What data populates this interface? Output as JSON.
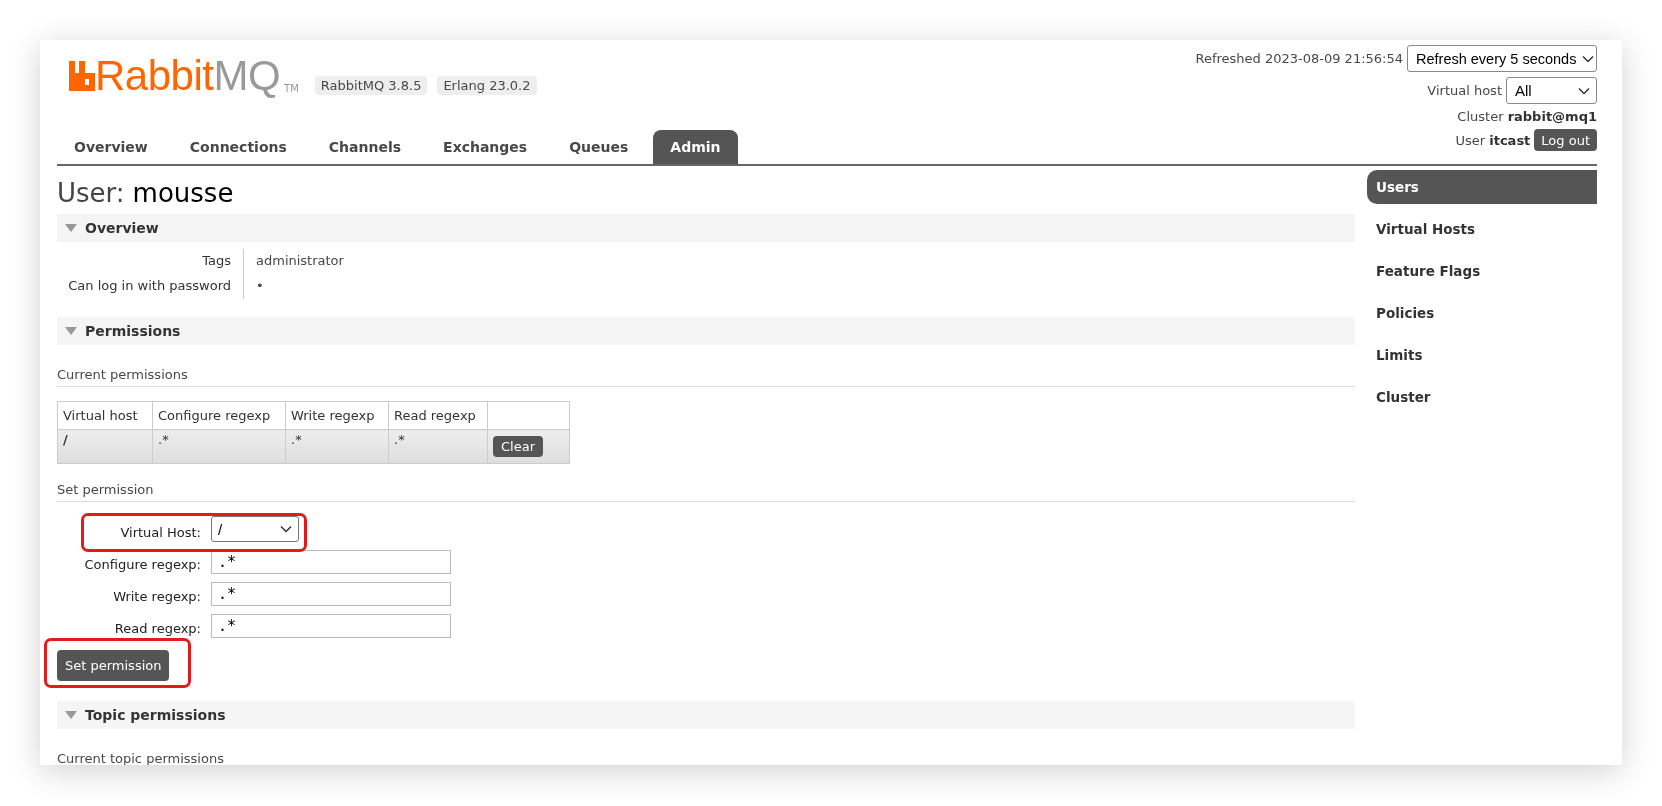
{
  "logo": {
    "brand": "Rabbit",
    "product": "MQ",
    "mark": "TM"
  },
  "versions": [
    "RabbitMQ 3.8.5",
    "Erlang 23.0.2"
  ],
  "tabs": [
    {
      "label": "Overview",
      "selected": false
    },
    {
      "label": "Connections",
      "selected": false
    },
    {
      "label": "Channels",
      "selected": false
    },
    {
      "label": "Exchanges",
      "selected": false
    },
    {
      "label": "Queues",
      "selected": false
    },
    {
      "label": "Admin",
      "selected": true
    }
  ],
  "header": {
    "refreshed": "Refreshed 2023-08-09 21:56:54",
    "refresh_select": "Refresh every 5 seconds",
    "vhost_label": "Virtual host",
    "vhost_select": "All",
    "cluster_label": "Cluster",
    "cluster": "rabbit@mq1",
    "user_label": "User",
    "user": "itcast",
    "logout": "Log out"
  },
  "page_title": {
    "prefix": "User:",
    "name": "mousse"
  },
  "overview": {
    "title": "Overview",
    "expanded": true,
    "rows": [
      {
        "label": "Tags",
        "value": "administrator"
      },
      {
        "label": "Can log in with password",
        "value": "•"
      }
    ]
  },
  "permissions": {
    "title": "Permissions",
    "expanded": true,
    "current_heading": "Current permissions",
    "table": {
      "columns": [
        "Virtual host",
        "Configure regexp",
        "Write regexp",
        "Read regexp"
      ],
      "rows": [
        {
          "cells": [
            "/",
            ".*",
            ".*",
            ".*"
          ],
          "action": "Clear"
        }
      ]
    },
    "set_heading": "Set permission",
    "form": [
      {
        "kind": "select",
        "label": "Virtual Host:",
        "value": "/",
        "highlighted": true
      },
      {
        "kind": "text",
        "label": "Configure regexp:",
        "value": ".*",
        "highlighted": false
      },
      {
        "kind": "text",
        "label": "Write regexp:",
        "value": ".*",
        "highlighted": false
      },
      {
        "kind": "text",
        "label": "Read regexp:",
        "value": ".*",
        "highlighted": false
      }
    ],
    "submit": {
      "label": "Set permission",
      "highlighted": true
    }
  },
  "topic_permissions": {
    "title": "Topic permissions",
    "expanded": true,
    "current_heading": "Current topic permissions"
  },
  "sidebar": [
    {
      "label": "Users",
      "selected": true
    },
    {
      "label": "Virtual Hosts",
      "selected": false
    },
    {
      "label": "Feature Flags",
      "selected": false
    },
    {
      "label": "Policies",
      "selected": false
    },
    {
      "label": "Limits",
      "selected": false
    },
    {
      "label": "Cluster",
      "selected": false
    }
  ]
}
